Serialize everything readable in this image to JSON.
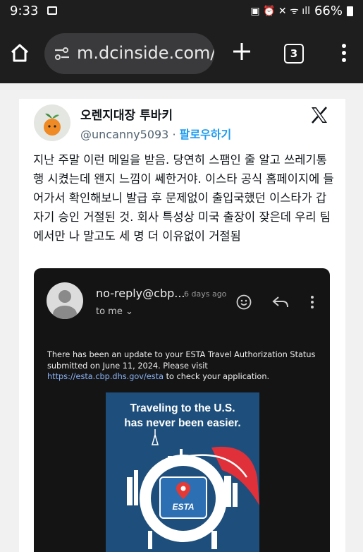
{
  "status_bar": {
    "time": "9:33",
    "battery": "66%"
  },
  "browser": {
    "url": "m.dcinside.com/b",
    "tab_count": "3"
  },
  "tweet": {
    "author_name": "오렌지대장 투바키",
    "handle": "@uncanny5093",
    "separator": " · ",
    "follow_label": "팔로우하기",
    "text": "지난 주말 이런 메일을 받음. 당연히 스팸인 줄 알고 쓰레기통행 시켰는데 왠지 느낌이 쎄한거야. 이스타 공식 홈페이지에 들어가서 확인해보니 발급 후 문제없이 출입국했던 이스타가 갑자기 승인 거절된 것. 회사 특성상 미국 출장이 잦은데 우리 팀에서만 나 말고도 세 명 더 이유없이 거절됨"
  },
  "email": {
    "sender": "no-reply@cbp...",
    "time_ago": "6 days ago",
    "recipient": "to me",
    "body_before": "There has been an update to your ESTA Travel Authorization Status submitted on June 11, 2024. Please visit ",
    "link": "https://esta.cbp.dhs.gov/esta",
    "body_after": " to check your application.",
    "banner_line1": "Traveling to the U.S.",
    "banner_line2": "has never been easier.",
    "esta_label": "ESTA"
  },
  "colors": {
    "browser_bg": "#1e1e1e",
    "follow_link": "#1d9bf0",
    "email_link": "#8ab4f8",
    "banner_bg": "#1e4f7c",
    "esta_pin": "#e53935"
  }
}
